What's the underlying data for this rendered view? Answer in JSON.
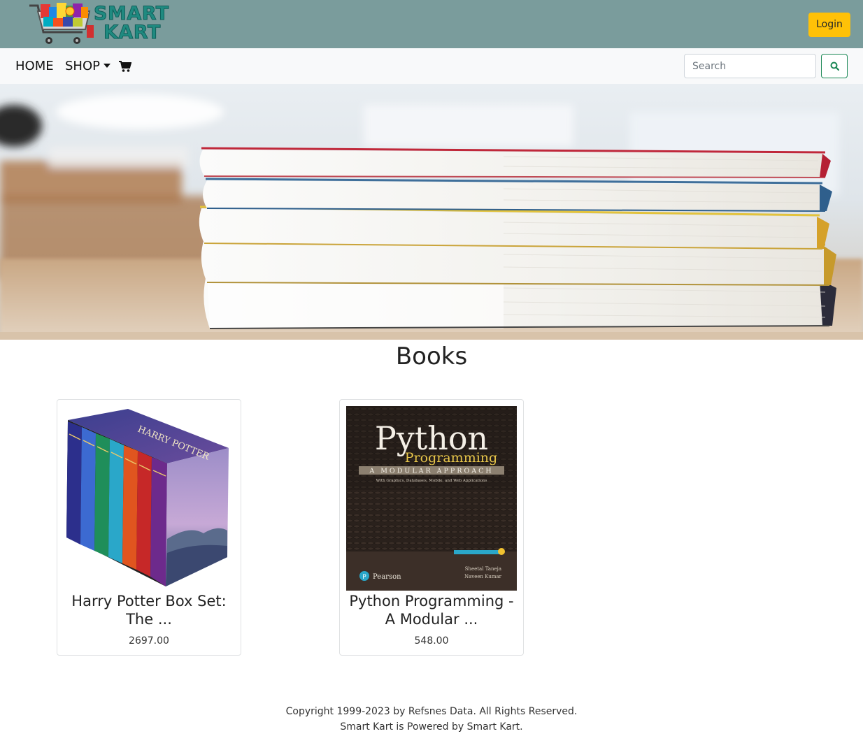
{
  "brand": {
    "logo_line1": "SMART",
    "logo_line2": "KART",
    "logo_icon": "shopping-cart-icon",
    "primary_color": "#7a9c9c",
    "logo_color": "#1f8a80"
  },
  "header": {
    "login_label": "Login",
    "login_color": "#ffc107"
  },
  "nav": {
    "home_label": "HOME",
    "shop_label": "SHOP",
    "cart_icon": "cart-icon",
    "search_placeholder": "Search",
    "search_value": "",
    "search_icon": "search-icon",
    "search_button_color": "#198754"
  },
  "hero": {
    "image": "stack-of-books-banner"
  },
  "section": {
    "title": "Books"
  },
  "products": [
    {
      "title": "Harry Potter Box Set: The ...",
      "price": "2697.00",
      "image": "harry-potter-box-set-cover"
    },
    {
      "title": "Python Programming - A Modular ...",
      "price": "548.00",
      "image": "python-programming-cover"
    }
  ],
  "footer": {
    "copyright": "Copyright 1999-2023 by Refsnes Data. All Rights Reserved.",
    "powered_by": "Smart Kart is Powered by Smart Kart."
  }
}
